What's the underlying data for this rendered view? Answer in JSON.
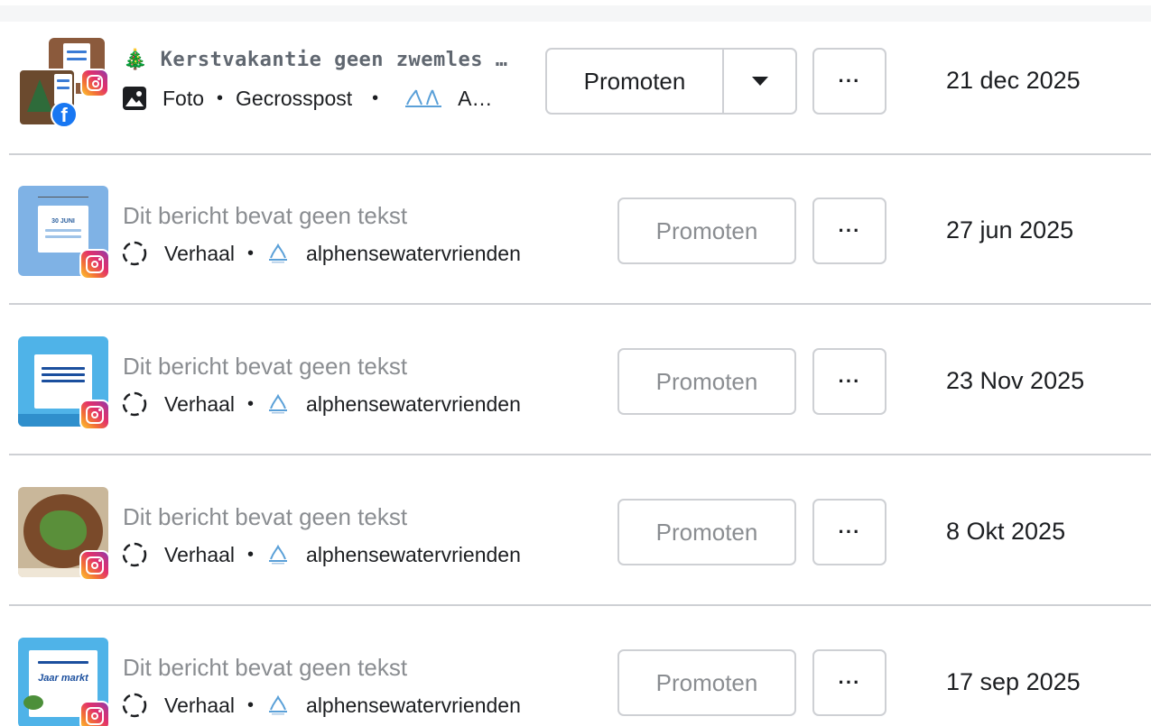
{
  "posts": [
    {
      "title": "🎄 Kerstvakantie geen zwemles …",
      "type_label": "Foto",
      "extra_label": "Gecrosspost",
      "account": "A…",
      "promote_label": "Promoten",
      "more_label": "···",
      "date": "21 dec 2025",
      "platforms": [
        "instagram",
        "facebook"
      ],
      "type_icon": "image-icon"
    },
    {
      "title": "Dit bericht bevat geen tekst",
      "type_label": "Verhaal",
      "account": "alphensewatervrienden",
      "promote_label": "Promoten",
      "more_label": "···",
      "date": "27 jun 2025",
      "thumb_text": "30 JUNI",
      "type_icon": "story-icon"
    },
    {
      "title": "Dit bericht bevat geen tekst",
      "type_label": "Verhaal",
      "account": "alphensewatervrienden",
      "promote_label": "Promoten",
      "more_label": "···",
      "date": "23 Nov 2025",
      "type_icon": "story-icon"
    },
    {
      "title": "Dit bericht bevat geen tekst",
      "type_label": "Verhaal",
      "account": "alphensewatervrienden",
      "promote_label": "Promoten",
      "more_label": "···",
      "date": "8 Okt 2025",
      "type_icon": "story-icon"
    },
    {
      "title": "Dit bericht bevat geen tekst",
      "type_label": "Verhaal",
      "account": "alphensewatervrienden",
      "promote_label": "Promoten",
      "more_label": "···",
      "date": "17 sep 2025",
      "thumb_text": "Jaar markt",
      "type_icon": "story-icon"
    }
  ],
  "colors": {
    "divider": "#ced0d4",
    "muted_text": "#8a8d91",
    "facebook_blue": "#1877f2",
    "thumb_blue": "#7fb2e5"
  }
}
